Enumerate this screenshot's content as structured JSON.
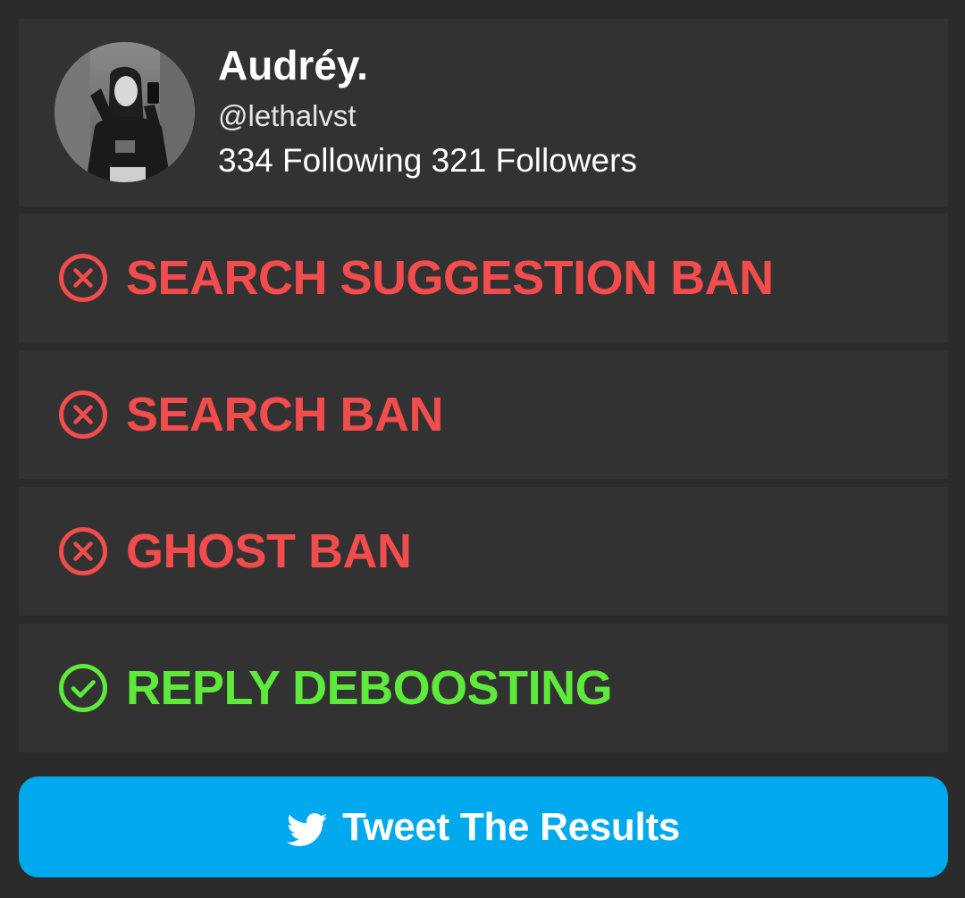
{
  "profile": {
    "display_name": "Audréy.",
    "handle": "@lethalvst",
    "stats_text": "334 Following 321 Followers"
  },
  "checks": [
    {
      "label": "SEARCH SUGGESTION BAN",
      "status": "fail",
      "icon": "x-circle-icon"
    },
    {
      "label": "SEARCH BAN",
      "status": "fail",
      "icon": "x-circle-icon"
    },
    {
      "label": "GHOST BAN",
      "status": "fail",
      "icon": "x-circle-icon"
    },
    {
      "label": "REPLY DEBOOSTING",
      "status": "pass",
      "icon": "check-circle-icon"
    }
  ],
  "tweet_button": {
    "label": "Tweet The Results",
    "icon": "twitter-bird-icon"
  },
  "colors": {
    "background": "#2b2b2b",
    "card": "#323232",
    "fail": "#f24c4c",
    "pass": "#5eea3a",
    "button": "#00a9ee",
    "text": "#ffffff"
  }
}
